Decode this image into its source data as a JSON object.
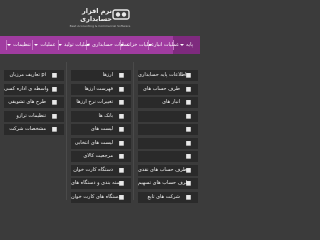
{
  "logo": {
    "title": "نرم افزار حسابداری",
    "subtitle": "Best Accounting & Commercial Software"
  },
  "nav": [
    {
      "label": "پایه",
      "active": true
    },
    {
      "label": "عملیات انبار"
    },
    {
      "label": "عملیات خزانه"
    },
    {
      "label": "عملیات حسابداری"
    },
    {
      "label": "عملیات تولید"
    },
    {
      "label": "عملیات"
    },
    {
      "label": "تنظیمات"
    },
    {
      "label": ""
    }
  ],
  "menu_right": [
    {
      "label": "اطلاعات پایه حسابداری",
      "icon": "document-icon"
    },
    {
      "label": "طرف حساب های",
      "icon": "contacts-icon"
    },
    {
      "label": "انبار های",
      "icon": "warehouse-icon"
    },
    {
      "label": "",
      "icon": "store-icon"
    },
    {
      "label": "",
      "icon": "people-icon"
    },
    {
      "label": "",
      "icon": "box-icon"
    },
    {
      "label": "",
      "icon": "scale-icon"
    },
    {
      "label": "طرف حساب های نقدی",
      "icon": "cash-icon"
    },
    {
      "label": "طرف حساب های تسهیم",
      "icon": "split-icon"
    },
    {
      "label": "شرکت های تابع",
      "icon": "company-icon"
    }
  ],
  "menu_middle": [
    {
      "label": "ارزها",
      "icon": "currency-icon"
    },
    {
      "label": "فهرست ارزها",
      "icon": "list-icon"
    },
    {
      "label": "تغییرات نرخ ارزها",
      "icon": "rate-icon"
    },
    {
      "label": "بانک ها",
      "icon": "bank-icon"
    },
    {
      "label": "لیست های",
      "icon": "list2-icon"
    },
    {
      "label": "لیست های انتخابی",
      "icon": "check-list-icon"
    },
    {
      "label": "مرجعیت کالای",
      "icon": "reference-icon"
    },
    {
      "label": "دستگاه کارت خوان",
      "icon": "pos-icon"
    },
    {
      "label": "دسته بندی و دستگاه های",
      "icon": "category-icon"
    },
    {
      "label": "دستگاه های کارت خوان",
      "icon": "card-reader-icon"
    }
  ],
  "menu_left": [
    {
      "label": "تعاریف مرزبان pi",
      "icon": "settings-icon"
    },
    {
      "label": "واسطه ی اداره کسی",
      "icon": "agent-icon"
    },
    {
      "label": "طرح های تشویقی",
      "icon": "promo-icon"
    },
    {
      "label": "تنظیمات ترازو",
      "icon": "scale2-icon"
    },
    {
      "label": "مشخصات شرکت",
      "icon": "info-icon"
    }
  ]
}
